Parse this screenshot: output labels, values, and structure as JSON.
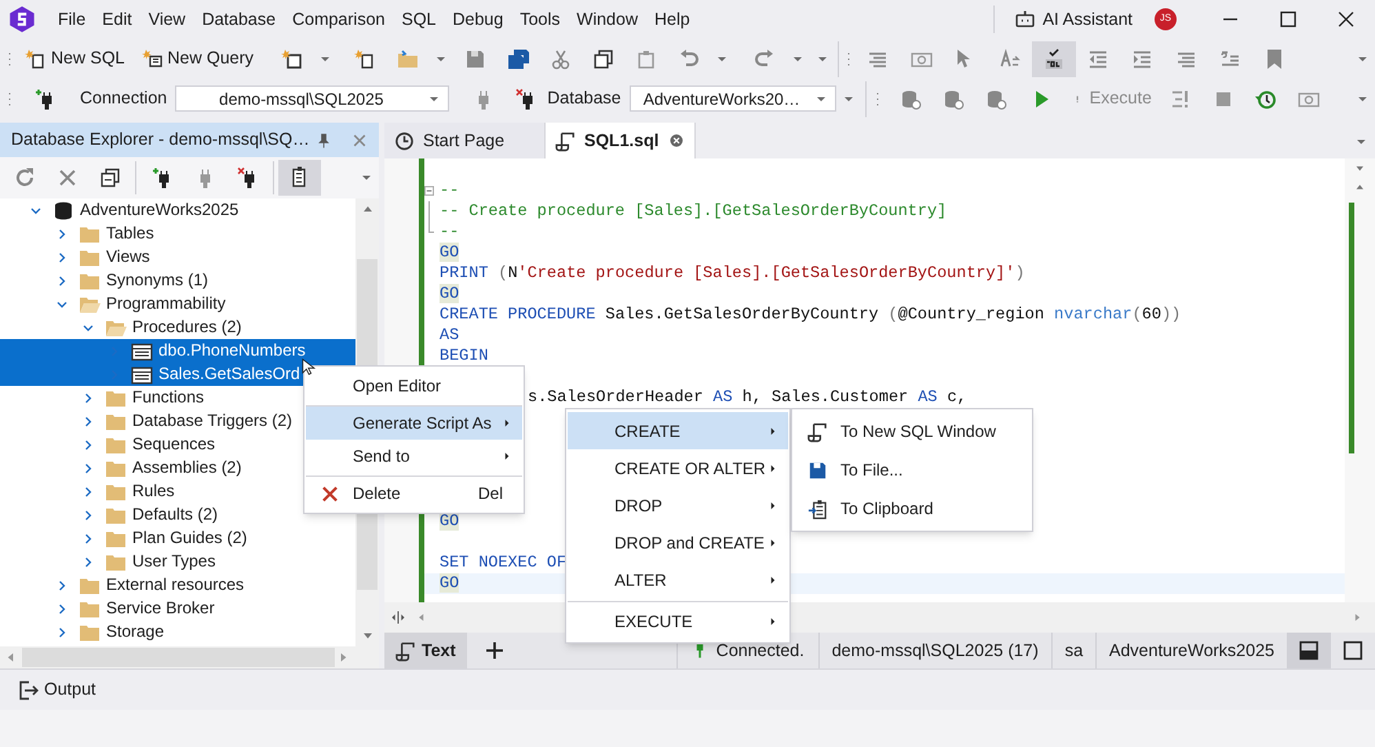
{
  "title_bar": {
    "menu": [
      "File",
      "Edit",
      "View",
      "Database",
      "Comparison",
      "SQL",
      "Debug",
      "Tools",
      "Window",
      "Help"
    ],
    "ai_assistant": "AI Assistant",
    "avatar": "JS"
  },
  "toolbar": {
    "new_sql": "New SQL",
    "new_query": "New Query"
  },
  "connection_bar": {
    "connection_label": "Connection",
    "connection": "demo-mssql\\SQL2025",
    "database_label": "Database",
    "database": "AdventureWorks20…",
    "execute": "Execute"
  },
  "explorer": {
    "title": "Database Explorer - demo-mssql\\SQ…",
    "tree": [
      {
        "label": "AdventureWorks2025",
        "kind": "database",
        "expanded": true,
        "selected": false,
        "children": [
          {
            "label": "Tables",
            "kind": "folder",
            "expanded": false,
            "selected": false
          },
          {
            "label": "Views",
            "kind": "folder",
            "expanded": false,
            "selected": false
          },
          {
            "label": "Synonyms (1)",
            "kind": "folder",
            "expanded": false,
            "selected": false
          },
          {
            "label": "Programmability",
            "kind": "folder",
            "expanded": true,
            "selected": false,
            "children": [
              {
                "label": "Procedures (2)",
                "kind": "folder",
                "expanded": true,
                "selected": false,
                "children": [
                  {
                    "label": "dbo.PhoneNumbers",
                    "kind": "procedure",
                    "expanded": false,
                    "selected": true
                  },
                  {
                    "label": "Sales.GetSalesOrd",
                    "kind": "procedure",
                    "expanded": false,
                    "selected": true
                  }
                ]
              },
              {
                "label": "Functions",
                "kind": "folder",
                "expanded": false,
                "selected": false
              },
              {
                "label": "Database Triggers (2)",
                "kind": "folder",
                "expanded": false,
                "selected": false
              },
              {
                "label": "Sequences",
                "kind": "folder",
                "expanded": false,
                "selected": false
              },
              {
                "label": "Assemblies (2)",
                "kind": "folder",
                "expanded": false,
                "selected": false
              },
              {
                "label": "Rules",
                "kind": "folder",
                "expanded": false,
                "selected": false
              },
              {
                "label": "Defaults (2)",
                "kind": "folder",
                "expanded": false,
                "selected": false
              },
              {
                "label": "Plan Guides (2)",
                "kind": "folder",
                "expanded": false,
                "selected": false
              },
              {
                "label": "User Types",
                "kind": "folder",
                "expanded": false,
                "selected": false
              }
            ]
          },
          {
            "label": "External resources",
            "kind": "folder",
            "expanded": false,
            "selected": false
          },
          {
            "label": "Service Broker",
            "kind": "folder",
            "expanded": false,
            "selected": false
          },
          {
            "label": "Storage",
            "kind": "folder",
            "expanded": false,
            "selected": false
          }
        ]
      }
    ]
  },
  "tabs": [
    {
      "label": "Start Page",
      "selected": false
    },
    {
      "label": "SQL1.sql",
      "selected": true
    }
  ],
  "editor": {
    "lines": [
      {
        "kind": "code",
        "current": false,
        "tokens": [
          {
            "kind": "comment",
            "text": "--"
          }
        ]
      },
      {
        "kind": "code",
        "current": false,
        "tokens": [
          {
            "kind": "comment",
            "text": "-- Create procedure [Sales].[GetSalesOrderByCountry]"
          }
        ]
      },
      {
        "kind": "code",
        "current": false,
        "tokens": [
          {
            "kind": "comment",
            "text": "--"
          }
        ]
      },
      {
        "kind": "code",
        "current": false,
        "tokens": [
          {
            "kind": "batch",
            "text": "GO"
          }
        ]
      },
      {
        "kind": "code",
        "current": false,
        "tokens": [
          {
            "kind": "keyword",
            "text": "PRINT"
          },
          {
            "kind": "punct",
            "text": " ("
          },
          {
            "kind": "plain",
            "text": "N"
          },
          {
            "kind": "string",
            "text": "'Create procedure [Sales].[GetSalesOrderByCountry]'"
          },
          {
            "kind": "punct",
            "text": ")"
          }
        ]
      },
      {
        "kind": "code",
        "current": false,
        "tokens": [
          {
            "kind": "batch",
            "text": "GO"
          }
        ]
      },
      {
        "kind": "code",
        "current": false,
        "tokens": [
          {
            "kind": "keyword",
            "text": "CREATE PROCEDURE"
          },
          {
            "kind": "plain",
            "text": " Sales.GetSalesOrderByCountry "
          },
          {
            "kind": "punct",
            "text": "("
          },
          {
            "kind": "plain",
            "text": "@Country_region "
          },
          {
            "kind": "type",
            "text": "nvarchar"
          },
          {
            "kind": "punct",
            "text": "("
          },
          {
            "kind": "number",
            "text": "60"
          },
          {
            "kind": "punct",
            "text": "))"
          }
        ]
      },
      {
        "kind": "code",
        "current": false,
        "tokens": [
          {
            "kind": "keyword",
            "text": "AS"
          }
        ]
      },
      {
        "kind": "code",
        "current": false,
        "tokens": [
          {
            "kind": "keyword",
            "text": "BEGIN"
          }
        ]
      },
      {
        "kind": "blank",
        "current": false
      },
      {
        "kind": "covered",
        "current": false,
        "tokens": [
          {
            "kind": "plain",
            "text": "s.SalesOrderHeader "
          },
          {
            "kind": "keyword",
            "text": "AS"
          },
          {
            "kind": "plain",
            "text": " h, Sales.Customer "
          },
          {
            "kind": "keyword",
            "text": "AS"
          },
          {
            "kind": "plain",
            "text": " c,"
          }
        ]
      },
      {
        "kind": "blank",
        "current": false
      },
      {
        "kind": "blank",
        "current": false
      },
      {
        "kind": "blank",
        "current": false
      },
      {
        "kind": "blank",
        "current": false
      },
      {
        "kind": "blank",
        "current": false
      },
      {
        "kind": "code",
        "current": false,
        "tokens": [
          {
            "kind": "batch",
            "text": "GO"
          }
        ]
      },
      {
        "kind": "blank",
        "current": false
      },
      {
        "kind": "code",
        "current": false,
        "tokens": [
          {
            "kind": "keyword",
            "text": "SET NOEXEC OF"
          }
        ]
      },
      {
        "kind": "code",
        "current": true,
        "tokens": [
          {
            "kind": "batch",
            "text": "GO"
          }
        ]
      }
    ]
  },
  "context_menu": [
    {
      "label": "Open Editor",
      "kind": "plain",
      "selected": false,
      "submenu": false,
      "separator_before": false
    },
    {
      "label": "Generate Script As",
      "kind": "plain",
      "selected": true,
      "submenu": true,
      "separator_before": true
    },
    {
      "label": "Send to",
      "kind": "plain",
      "selected": false,
      "submenu": true,
      "separator_before": false
    },
    {
      "label": "Delete",
      "kind": "delete",
      "selected": false,
      "submenu": false,
      "separator_before": true,
      "shortcut": "Del"
    }
  ],
  "script_menu": [
    {
      "label": "CREATE",
      "selected": true,
      "submenu": true,
      "separator_before": false
    },
    {
      "label": "CREATE OR ALTER",
      "selected": false,
      "submenu": true,
      "separator_before": false
    },
    {
      "label": "DROP",
      "selected": false,
      "submenu": true,
      "separator_before": false
    },
    {
      "label": "DROP and CREATE",
      "selected": false,
      "submenu": true,
      "separator_before": false
    },
    {
      "label": "ALTER",
      "selected": false,
      "submenu": true,
      "separator_before": false
    },
    {
      "label": "EXECUTE",
      "selected": false,
      "submenu": true,
      "separator_before": true
    }
  ],
  "target_menu": [
    {
      "label": "To New SQL Window"
    },
    {
      "label": "To File..."
    },
    {
      "label": "To Clipboard"
    }
  ],
  "document_tabs": [
    {
      "label": "Text",
      "selected": true
    }
  ],
  "status_bar": {
    "connection": "Connected.",
    "server": "demo-mssql\\SQL2025 (17)",
    "user": "sa",
    "database": "AdventureWorks2025"
  },
  "output": {
    "label": "Output"
  }
}
